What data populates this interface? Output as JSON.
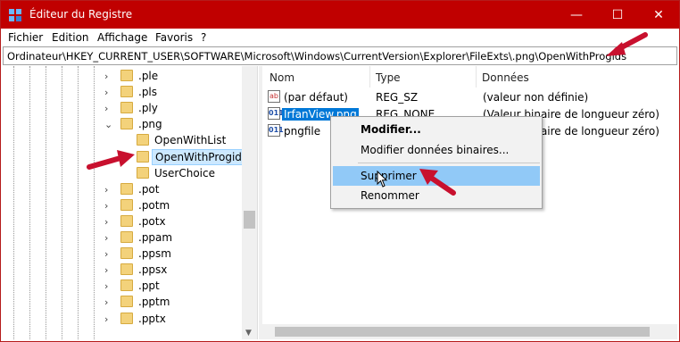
{
  "window": {
    "title": "Éditeur du Registre",
    "accent": "#c00000"
  },
  "titlebar": {
    "minimize": "—",
    "maximize": "☐",
    "close": "✕"
  },
  "menu": [
    "Fichier",
    "Edition",
    "Affichage",
    "Favoris",
    "?"
  ],
  "address": "Ordinateur\\HKEY_CURRENT_USER\\SOFTWARE\\Microsoft\\Windows\\CurrentVersion\\Explorer\\FileExts\\.png\\OpenWithProgids",
  "tree": {
    "items": [
      {
        "label": ".ple",
        "chevron": "›",
        "level": 1
      },
      {
        "label": ".pls",
        "chevron": "›",
        "level": 1
      },
      {
        "label": ".ply",
        "chevron": "›",
        "level": 1
      },
      {
        "label": ".png",
        "chevron": "⌄",
        "level": 1
      },
      {
        "label": "OpenWithList",
        "chevron": "",
        "level": 2
      },
      {
        "label": "OpenWithProgids",
        "chevron": "",
        "level": 2,
        "selected": true
      },
      {
        "label": "UserChoice",
        "chevron": "",
        "level": 2
      },
      {
        "label": ".pot",
        "chevron": "›",
        "level": 1
      },
      {
        "label": ".potm",
        "chevron": "›",
        "level": 1
      },
      {
        "label": ".potx",
        "chevron": "›",
        "level": 1
      },
      {
        "label": ".ppam",
        "chevron": "›",
        "level": 1
      },
      {
        "label": ".ppsm",
        "chevron": "›",
        "level": 1
      },
      {
        "label": ".ppsx",
        "chevron": "›",
        "level": 1
      },
      {
        "label": ".ppt",
        "chevron": "›",
        "level": 1
      },
      {
        "label": ".pptm",
        "chevron": "›",
        "level": 1
      },
      {
        "label": ".pptx",
        "chevron": "›",
        "level": 1
      }
    ]
  },
  "list": {
    "columns": [
      "Nom",
      "Type",
      "Données"
    ],
    "rows": [
      {
        "icon": "ab",
        "name": "(par défaut)",
        "type": "REG_SZ",
        "data": "(valeur non définie)"
      },
      {
        "icon": "011",
        "name": "IrfanView.png",
        "type": "REG_NONE",
        "data": "(Valeur binaire de longueur zéro)",
        "selected": true
      },
      {
        "icon": "011",
        "name": "pngfile",
        "type": "",
        "data": "(Valeur binaire de longueur zéro)"
      }
    ]
  },
  "context_menu": {
    "items": [
      "Modifier...",
      "Modifier données binaires...",
      "Supprimer",
      "Renommer"
    ],
    "hovered": "Supprimer"
  },
  "annotation_color": "#c8102e"
}
